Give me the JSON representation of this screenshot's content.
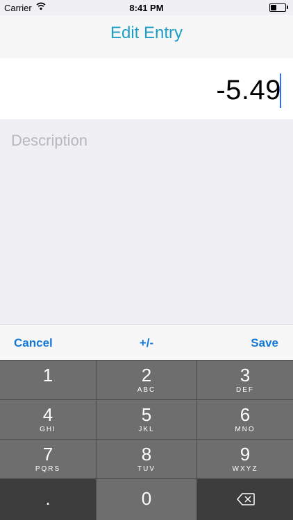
{
  "status_bar": {
    "carrier": "Carrier",
    "time": "8:41 PM"
  },
  "nav": {
    "title": "Edit Entry"
  },
  "entry": {
    "amount": "-5.49",
    "description_placeholder": "Description"
  },
  "toolbar": {
    "cancel_label": "Cancel",
    "sign_label": "+/-",
    "save_label": "Save"
  },
  "keypad": {
    "keys": [
      {
        "digit": "1",
        "letters": ""
      },
      {
        "digit": "2",
        "letters": "ABC"
      },
      {
        "digit": "3",
        "letters": "DEF"
      },
      {
        "digit": "4",
        "letters": "GHI"
      },
      {
        "digit": "5",
        "letters": "JKL"
      },
      {
        "digit": "6",
        "letters": "MNO"
      },
      {
        "digit": "7",
        "letters": "PQRS"
      },
      {
        "digit": "8",
        "letters": "TUV"
      },
      {
        "digit": "9",
        "letters": "WXYZ"
      },
      {
        "digit": ".",
        "letters": ""
      },
      {
        "digit": "0",
        "letters": ""
      }
    ],
    "delete_icon": "backspace-icon"
  },
  "colors": {
    "accent": "#1c9fc4",
    "button": "#1479d6",
    "keypad_bg": "#4a4a4a",
    "key_bg": "#6e6e6e"
  }
}
